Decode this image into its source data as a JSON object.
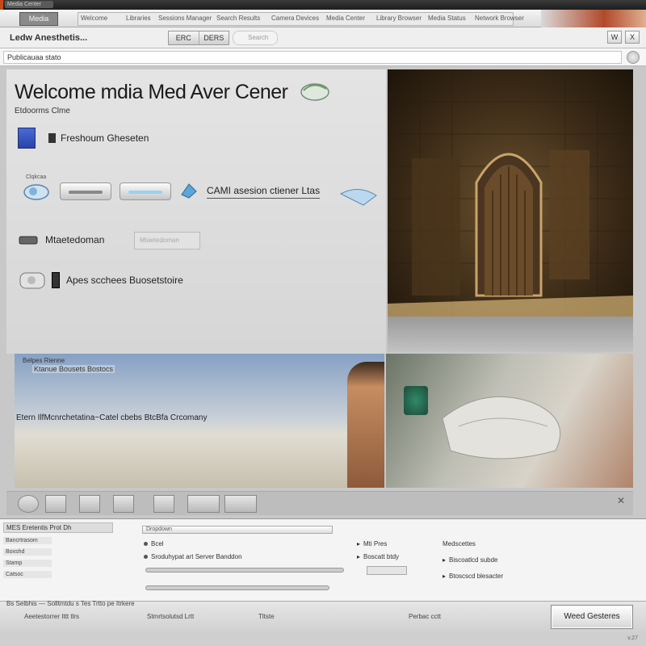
{
  "titlebar": {
    "app_name": "Media Center"
  },
  "tabs": {
    "active": "Media",
    "items": [
      "Welcome",
      "Libraries",
      "Sessions Manager",
      "Search Results",
      "Camera Devices",
      "Media Center",
      "Library Browser",
      "Media Status",
      "Network Browser"
    ]
  },
  "header": {
    "app_title": "Ledw Anesthetis...",
    "segment": [
      "ERC",
      "DERS"
    ],
    "search_placeholder": "Search",
    "win_btn_1": "W",
    "win_btn_2": "X"
  },
  "address": {
    "value": "Publicauaa stato"
  },
  "welcome": {
    "title": "Welcome mdia Med Aver Cener",
    "subtitle": "Etdoorms Clme",
    "row1_label": "Freshoum Gheseten",
    "camera_header": "Clqkcaa",
    "camera_label": "CAMI asesion ctiener Ltas",
    "row3_label": "Mtaetedoman",
    "row3_input": "Mtaetedoman",
    "row4_label": "Apes scchees Buosetstoire"
  },
  "beach_photo": {
    "caption_top": "Belpes Rienne",
    "caption_sub": "Ktanue Bousets Bostocs",
    "caption_main": "Etern IlfMcnrchetatina~Catel cbebs BtcBfa Crcomany"
  },
  "panel": {
    "left_header": "MES Eretentis Prot Dh",
    "left_items": [
      "Bancrtrasom",
      "Boxshd",
      "Stamp",
      "Catsoc"
    ],
    "dropdown": "Dropdown",
    "opt1": "Bcel",
    "opt2": "Sroduhypat art Server Banddon",
    "opt3": "Mti Pres",
    "opt4": "Boscatt btdy",
    "opt5": "Medscettes",
    "opt6": "Biscoatlcd subde",
    "opt7": "Btoscscd blesacter"
  },
  "statusbar": {
    "left": "Bs Selbhis — Solltmtdu s Tes Trtto pe Itrkere",
    "s1": "Aeetestorrer Ittt tlrs",
    "s2": "Stmrtsolutsd Lrtt",
    "s3": "Tltste",
    "s4": "Perbac cctt",
    "button": "Weed Gesteres"
  },
  "footer": {
    "version": "v.27"
  }
}
